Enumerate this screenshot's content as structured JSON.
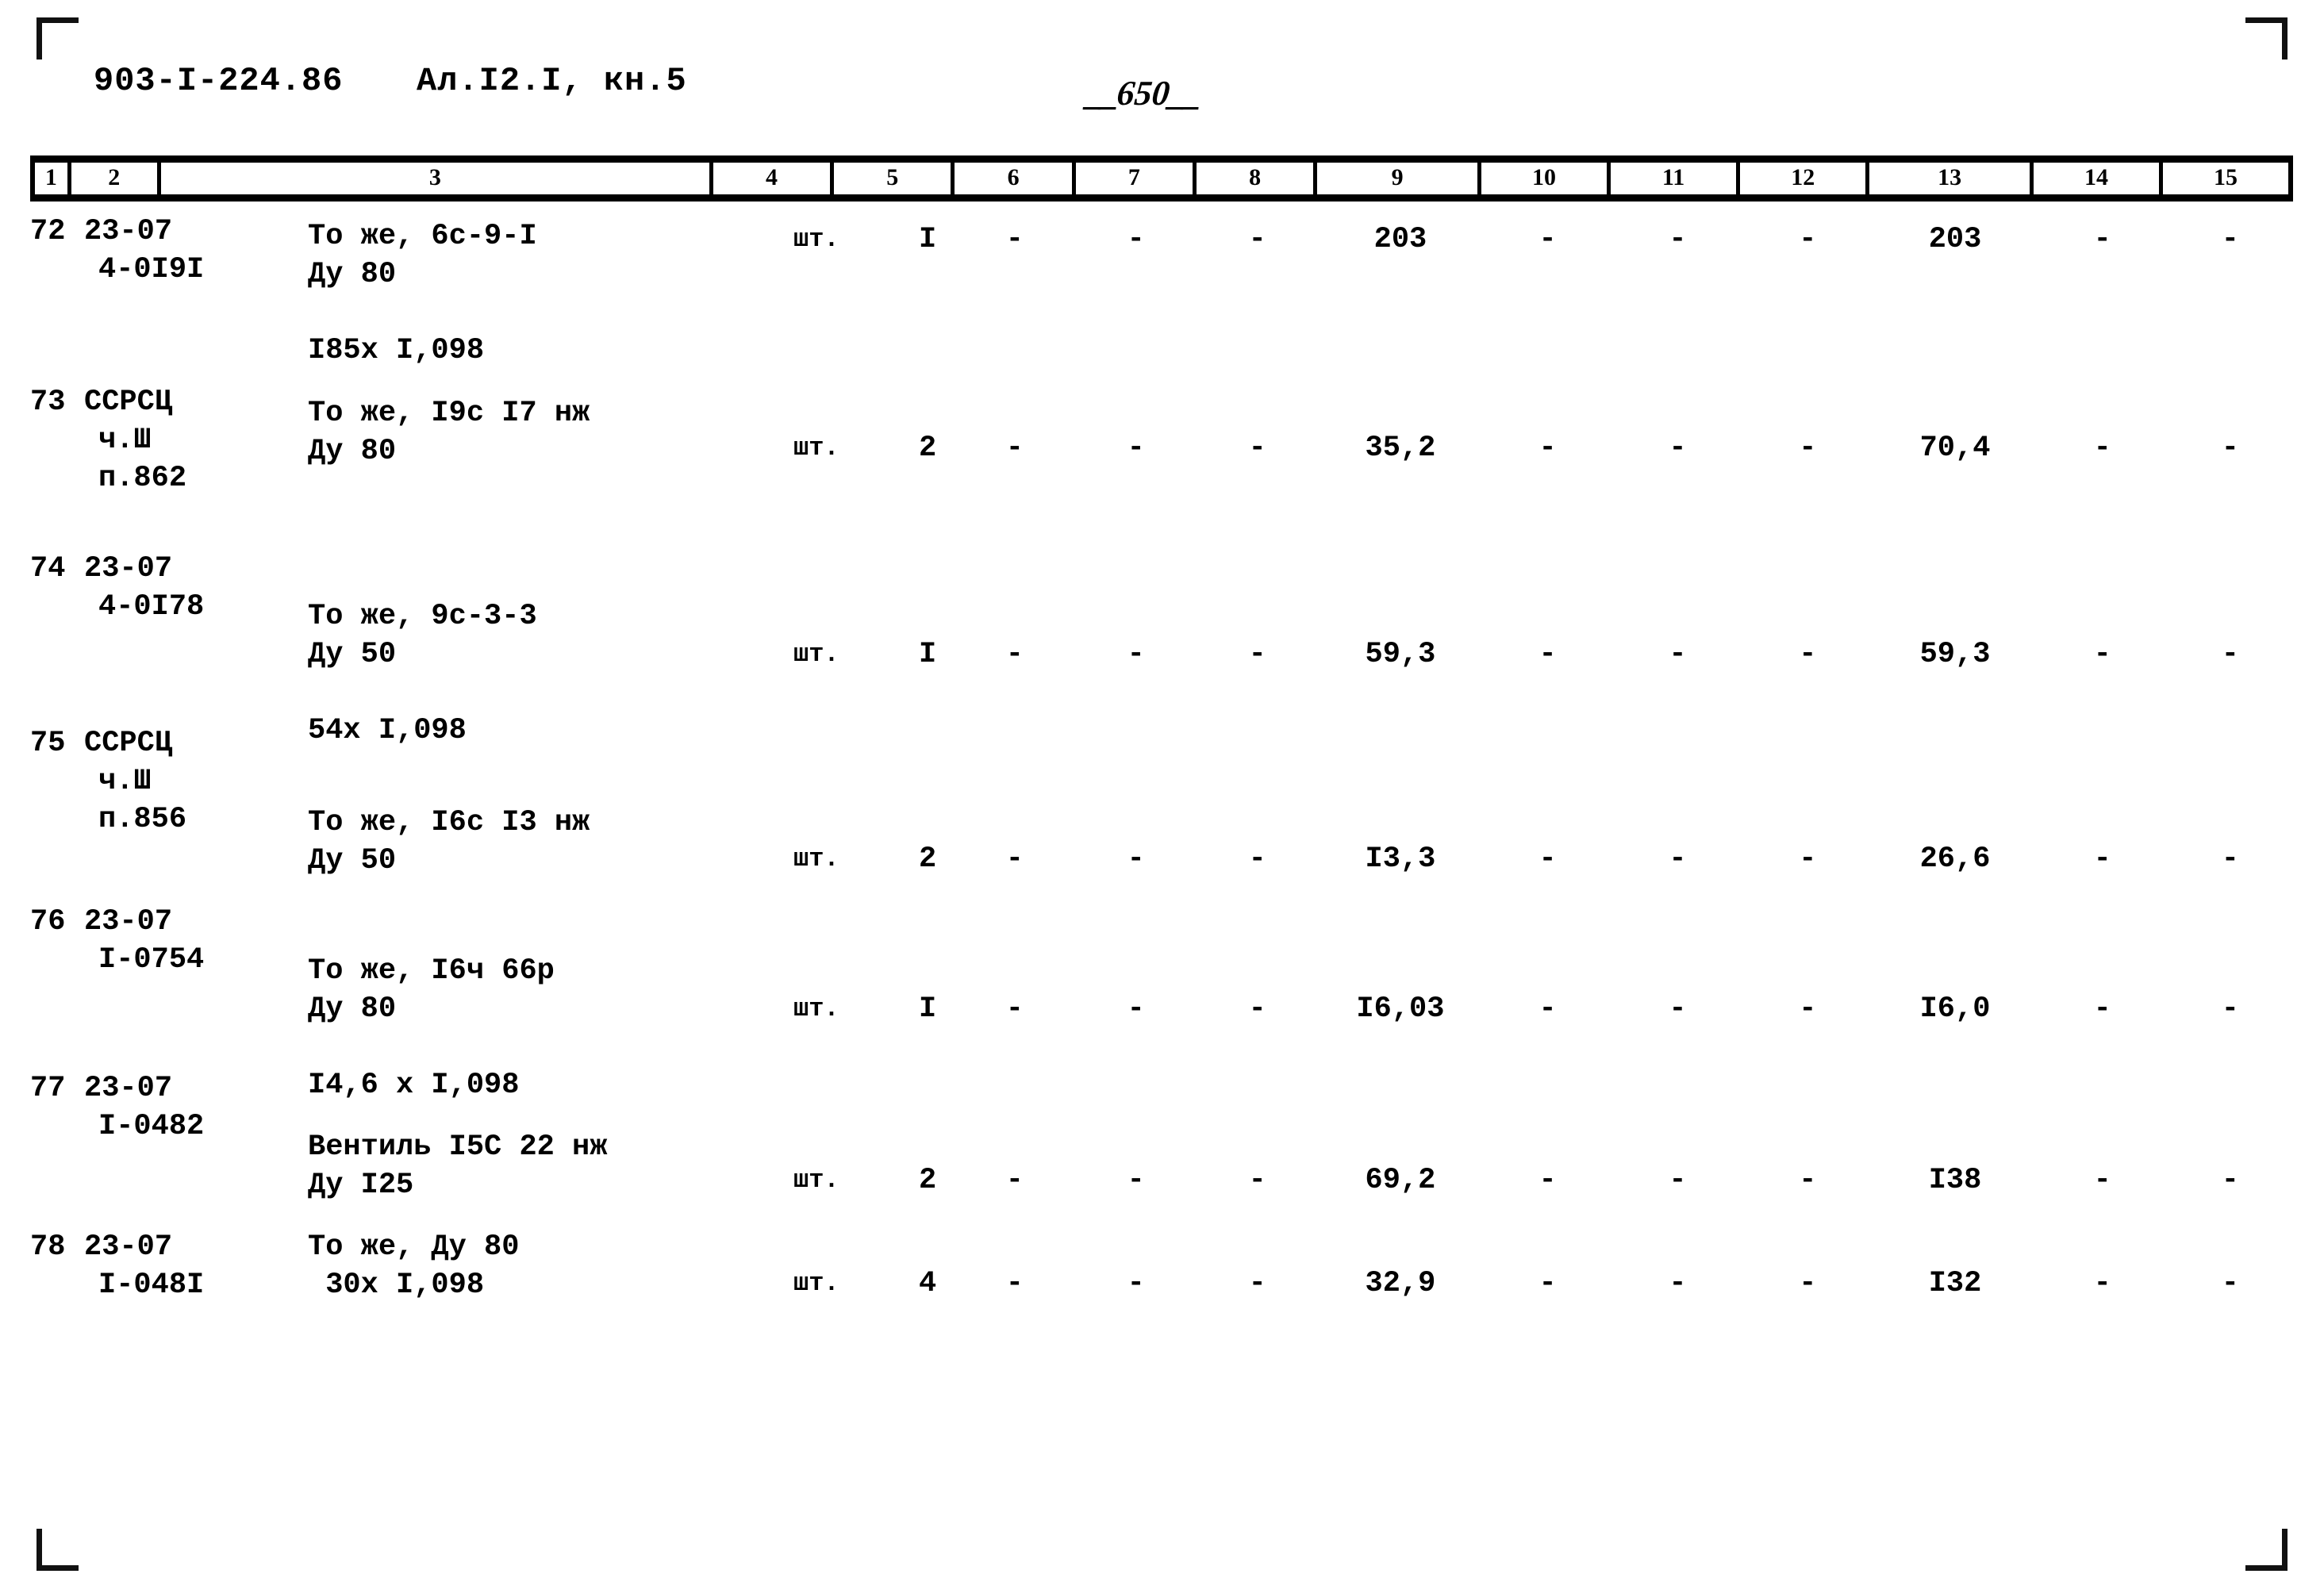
{
  "document": {
    "code": "903-I-224.86",
    "album": "Ал.I2.I, кн.5",
    "page_number": "650",
    "page_number_prefix": "__",
    "page_number_suffix": "__"
  },
  "table": {
    "column_headers": [
      "1",
      "2",
      "3",
      "4",
      "5",
      "6",
      "7",
      "8",
      "9",
      "10",
      "11",
      "12",
      "13",
      "14",
      "15"
    ],
    "dash": "-",
    "rows": [
      {
        "pos": "72",
        "code_lines": [
          "23-07",
          "4-0I9I"
        ],
        "name_lines": [
          "То же, 6с-9-I",
          "Ду 80",
          "",
          "I85х I,098"
        ],
        "unit": "шт.",
        "qty": "I",
        "col6": "-",
        "col7": "-",
        "col8": "-",
        "col9": "203",
        "col10": "-",
        "col11": "-",
        "col12": "-",
        "col13": "203",
        "col14": "-",
        "col15": "-"
      },
      {
        "pos": "73",
        "code_lines": [
          "ССРСЦ",
          "ч.Ш",
          "п.862"
        ],
        "name_lines": [
          "То же, I9с I7 нж",
          "Ду 80"
        ],
        "unit": "шт.",
        "qty": "2",
        "col6": "-",
        "col7": "-",
        "col8": "-",
        "col9": "35,2",
        "col10": "-",
        "col11": "-",
        "col12": "-",
        "col13": "70,4",
        "col14": "-",
        "col15": "-"
      },
      {
        "pos": "74",
        "code_lines": [
          "23-07",
          "4-0I78"
        ],
        "name_lines": [
          "То же, 9с-3-3",
          "Ду 50",
          "",
          "54х I,098"
        ],
        "unit": "шт.",
        "qty": "I",
        "col6": "-",
        "col7": "-",
        "col8": "-",
        "col9": "59,3",
        "col10": "-",
        "col11": "-",
        "col12": "-",
        "col13": "59,3",
        "col14": "-",
        "col15": "-"
      },
      {
        "pos": "75",
        "code_lines": [
          "ССРСЦ",
          "ч.Ш",
          "п.856"
        ],
        "name_lines": [
          "То же, I6с I3 нж",
          "Ду 50"
        ],
        "unit": "шт.",
        "qty": "2",
        "col6": "-",
        "col7": "-",
        "col8": "-",
        "col9": "I3,3",
        "col10": "-",
        "col11": "-",
        "col12": "-",
        "col13": "26,6",
        "col14": "-",
        "col15": "-"
      },
      {
        "pos": "76",
        "code_lines": [
          "23-07",
          "I-0754"
        ],
        "name_lines": [
          "То же, I6ч 66р",
          "Ду 80",
          "",
          "I4,6 х I,098"
        ],
        "unit": "шт.",
        "qty": "I",
        "col6": "-",
        "col7": "-",
        "col8": "-",
        "col9": "I6,03",
        "col10": "-",
        "col11": "-",
        "col12": "-",
        "col13": "I6,0",
        "col14": "-",
        "col15": "-"
      },
      {
        "pos": "77",
        "code_lines": [
          "23-07",
          "I-0482"
        ],
        "name_lines": [
          "Вентиль I5С 22 нж",
          "Ду I25"
        ],
        "unit": "шт.",
        "qty": "2",
        "col6": "-",
        "col7": "-",
        "col8": "-",
        "col9": "69,2",
        "col10": "-",
        "col11": "-",
        "col12": "-",
        "col13": "I38",
        "col14": "-",
        "col15": "-"
      },
      {
        "pos": "78",
        "code_lines": [
          "23-07",
          "I-048I"
        ],
        "name_lines": [
          "То же, Ду 80",
          " 30х I,098"
        ],
        "unit": "шт.",
        "qty": "4",
        "col6": "-",
        "col7": "-",
        "col8": "-",
        "col9": "32,9",
        "col10": "-",
        "col11": "-",
        "col12": "-",
        "col13": "I32",
        "col14": "-",
        "col15": "-"
      }
    ]
  }
}
